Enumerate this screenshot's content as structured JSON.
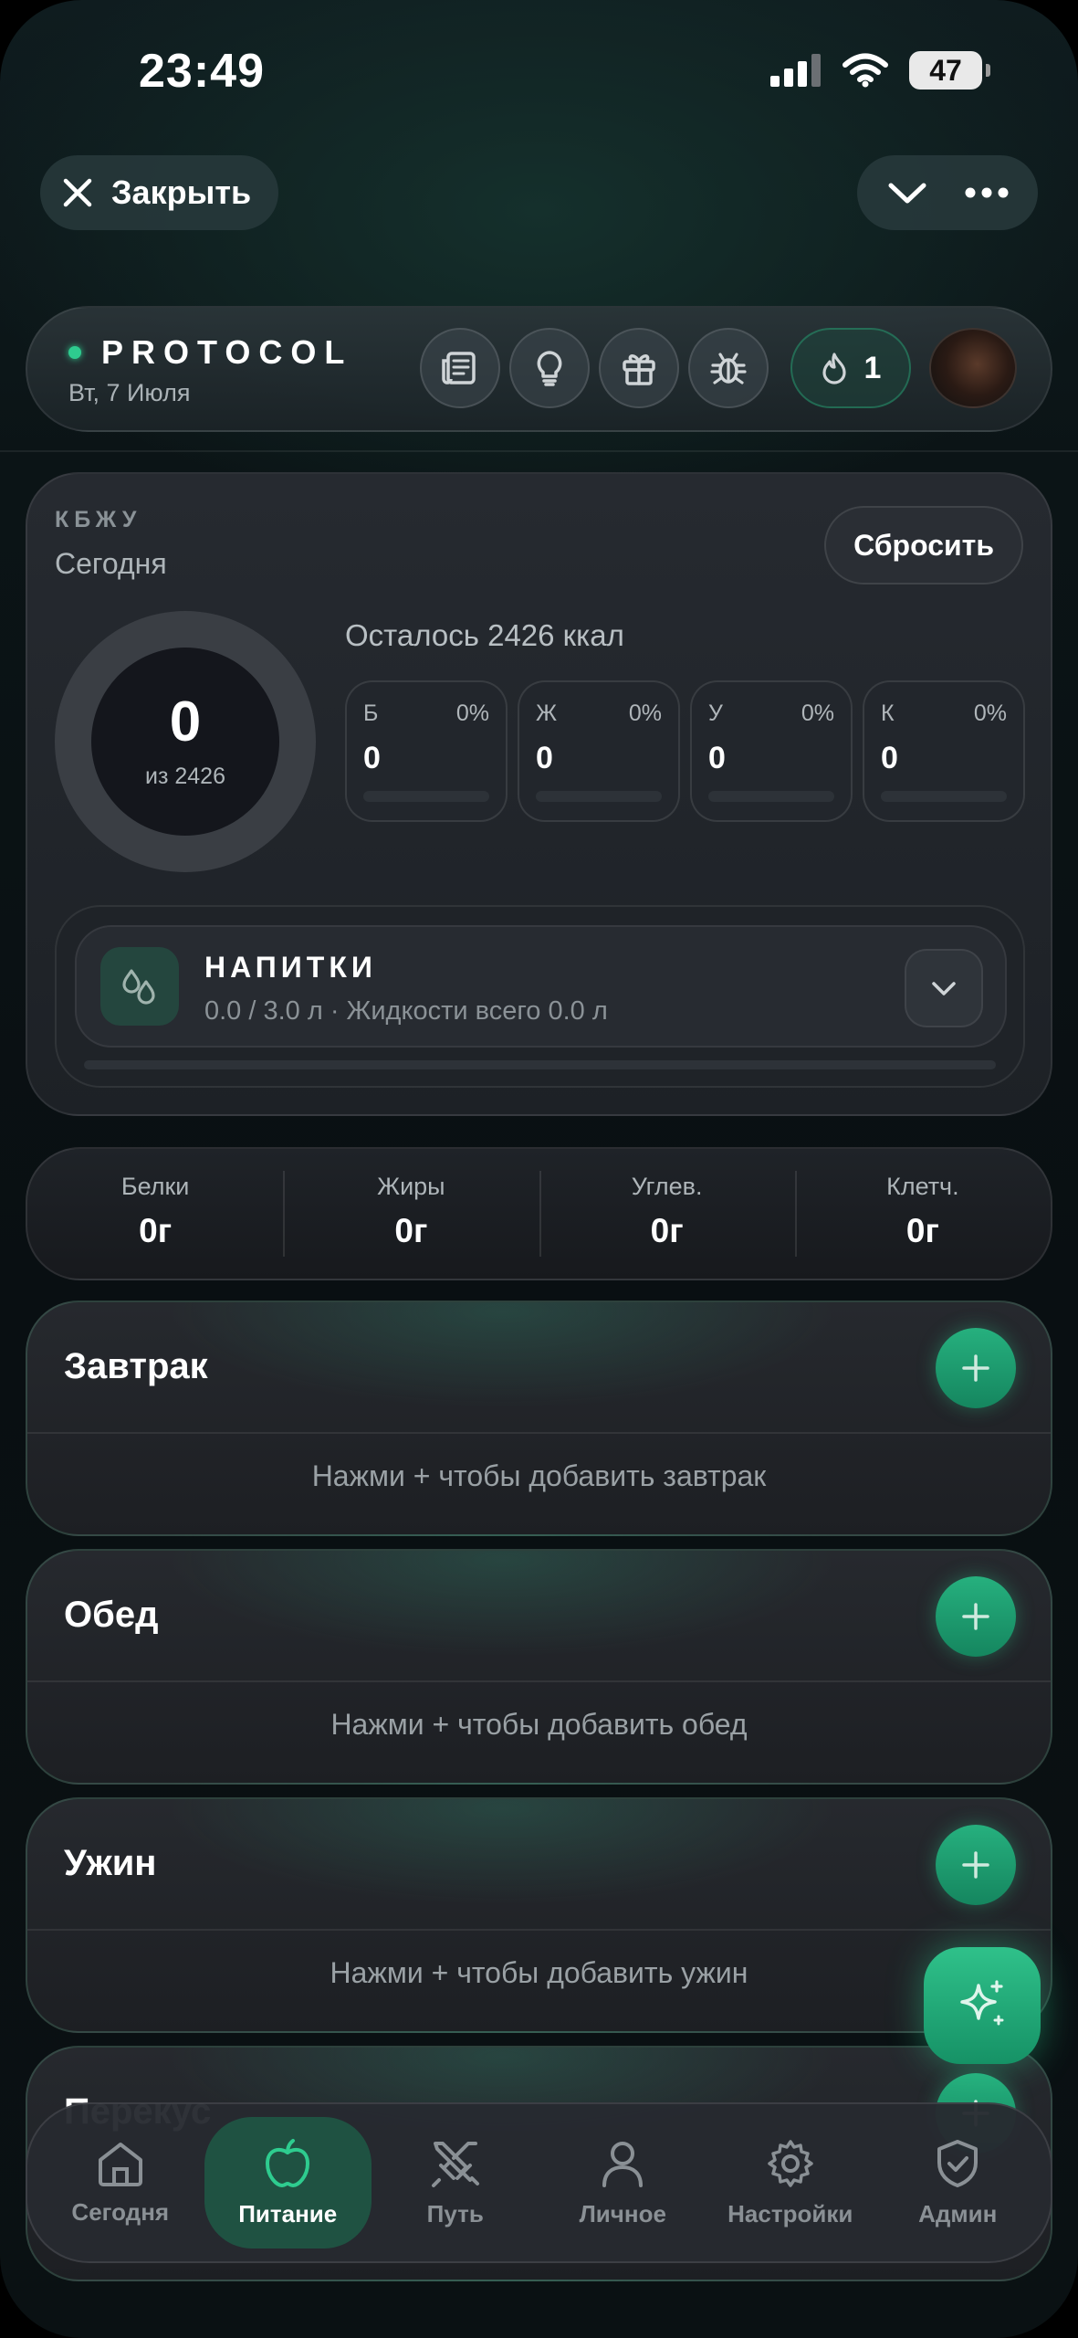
{
  "status": {
    "time": "23:49",
    "battery": "47"
  },
  "nav": {
    "close_label": "Закрыть"
  },
  "header": {
    "brand": "PROTOCOL",
    "date": "Вт, 7 Июля",
    "streak_count": "1",
    "icons": [
      "newspaper-icon",
      "lightbulb-icon",
      "gift-icon",
      "bug-icon"
    ]
  },
  "kbju": {
    "label": "КБЖУ",
    "period": "Сегодня",
    "reset_label": "Сбросить",
    "calories_value": "0",
    "calories_goal_text": "из 2426",
    "calories_progress": 0,
    "remaining_text": "Осталось 2426 ккал",
    "macros": [
      {
        "letter": "Б",
        "percent": "0%",
        "value": "0",
        "progress": 0
      },
      {
        "letter": "Ж",
        "percent": "0%",
        "value": "0",
        "progress": 0
      },
      {
        "letter": "У",
        "percent": "0%",
        "value": "0",
        "progress": 0
      },
      {
        "letter": "К",
        "percent": "0%",
        "value": "0",
        "progress": 0
      }
    ],
    "drinks": {
      "title": "НАПИТКИ",
      "subtitle": "0.0 / 3.0 л · Жидкости всего 0.0 л",
      "progress": 0
    }
  },
  "summary": [
    {
      "label": "Белки",
      "value": "0г"
    },
    {
      "label": "Жиры",
      "value": "0г"
    },
    {
      "label": "Углев.",
      "value": "0г"
    },
    {
      "label": "Клетч.",
      "value": "0г"
    }
  ],
  "meals": [
    {
      "title": "Завтрак",
      "hint": "Нажми + чтобы добавить завтрак"
    },
    {
      "title": "Обед",
      "hint": "Нажми + чтобы добавить обед"
    },
    {
      "title": "Ужин",
      "hint": "Нажми + чтобы добавить ужин"
    },
    {
      "title": "Перекус"
    }
  ],
  "bottom_nav": [
    {
      "label": "Сегодня",
      "icon": "home-icon",
      "active": false
    },
    {
      "label": "Питание",
      "icon": "apple-icon",
      "active": true
    },
    {
      "label": "Путь",
      "icon": "swords-icon",
      "active": false
    },
    {
      "label": "Личное",
      "icon": "user-icon",
      "active": false
    },
    {
      "label": "Настройки",
      "icon": "gear-icon",
      "active": false
    },
    {
      "label": "Админ",
      "icon": "shield-icon",
      "active": false
    }
  ],
  "colors": {
    "accent": "#2ecc8f",
    "background": "#0b1416",
    "card": "#1f2328"
  }
}
